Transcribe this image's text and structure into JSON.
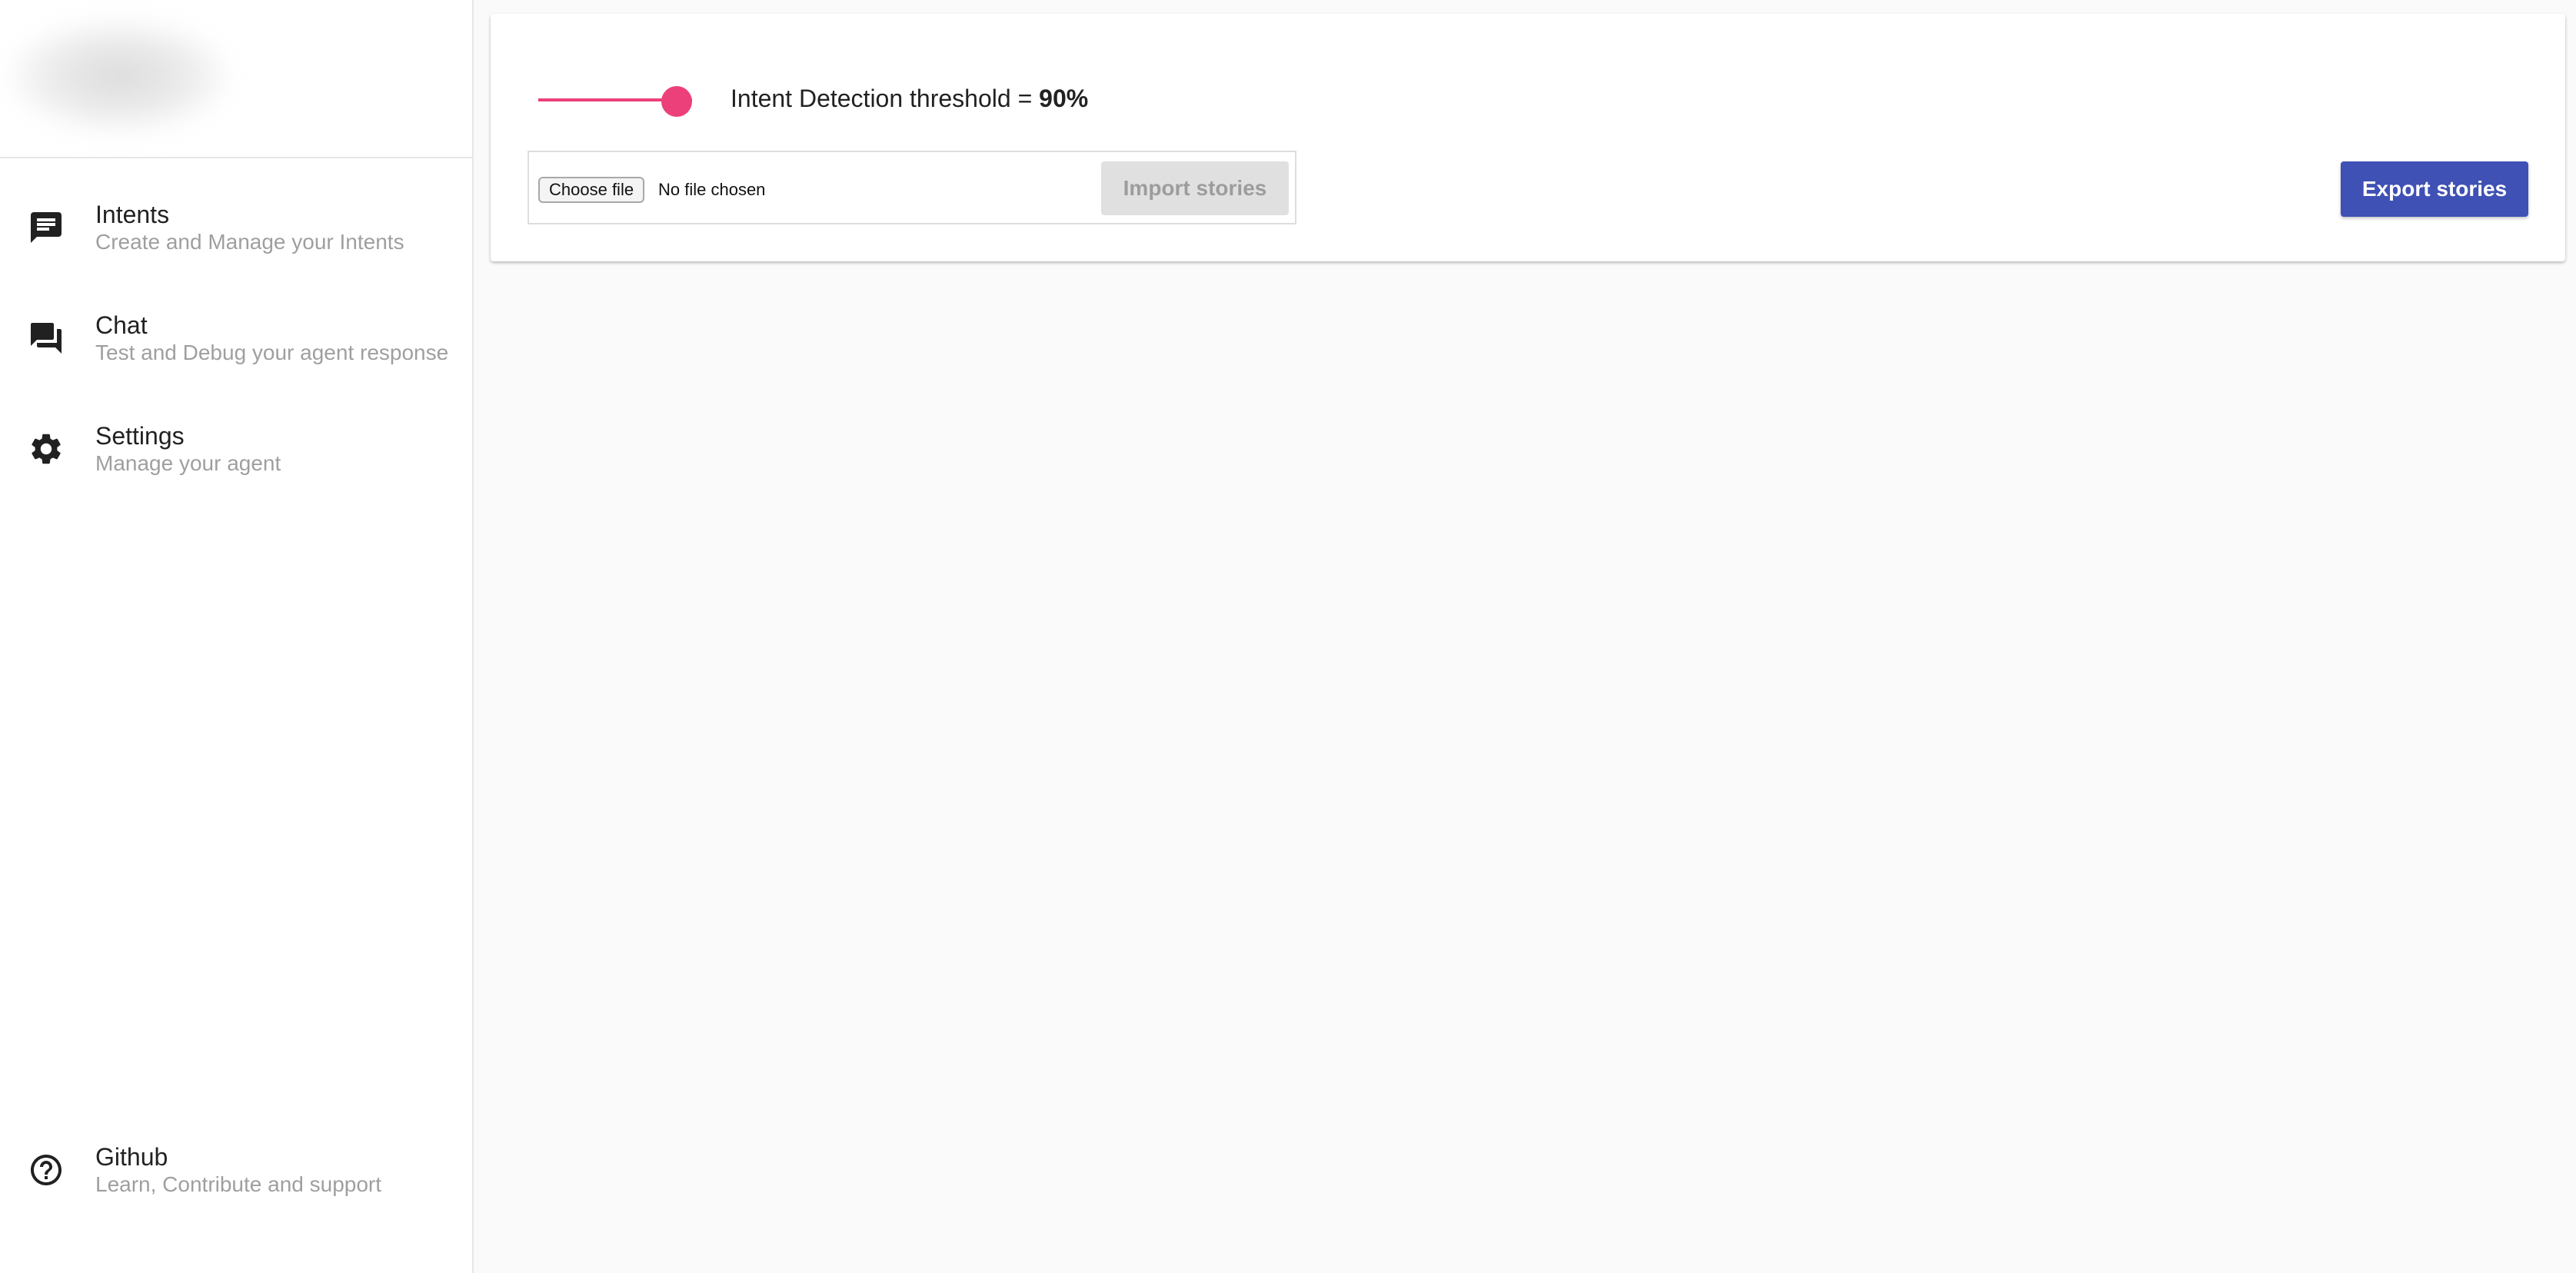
{
  "sidebar": {
    "items": [
      {
        "title": "Intents",
        "subtitle": "Create and Manage your Intents",
        "icon": "chat-list-icon"
      },
      {
        "title": "Chat",
        "subtitle": "Test and Debug your agent response",
        "icon": "forum-icon"
      },
      {
        "title": "Settings",
        "subtitle": "Manage your agent",
        "icon": "gear-icon"
      }
    ],
    "footer": {
      "title": "Github",
      "subtitle": "Learn, Contribute and support",
      "icon": "help-circle-icon"
    }
  },
  "settings_card": {
    "threshold_label": "Intent Detection threshold = ",
    "threshold_value": "90%",
    "threshold_fraction": 0.9,
    "slider_color": "#ec407a",
    "file_input": {
      "button_label": "Choose file",
      "status": "No file chosen"
    },
    "import_button": "Import stories",
    "export_button": "Export stories",
    "export_color": "#3f51b5"
  }
}
